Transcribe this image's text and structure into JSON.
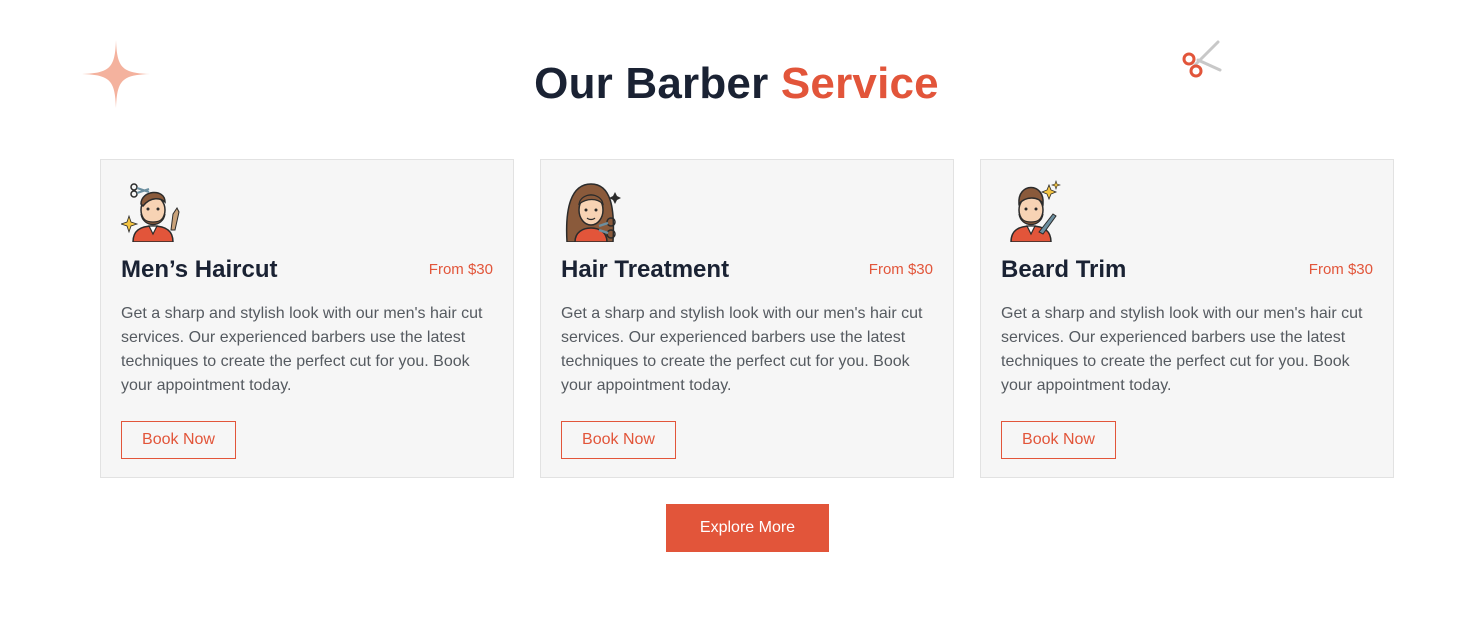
{
  "section": {
    "title_main": "Our Barber",
    "title_accent": "Service",
    "accent_color": "#e2553a",
    "decorations": [
      "sparkle-icon",
      "scissors-icon"
    ]
  },
  "cards": [
    {
      "icon": "barber-haircut-icon",
      "name": "Men’s Haircut",
      "price": "From $30",
      "description": "Get a sharp and stylish look with our men's hair cut services. Our experienced barbers use the latest techniques to create the perfect cut for you. Book your appointment today.",
      "button_label": "Book Now"
    },
    {
      "icon": "hair-treatment-icon",
      "name": "Hair Treatment",
      "price": "From $30",
      "description": "Get a sharp and stylish look with our men's hair cut services. Our experienced barbers use the latest techniques to create the perfect cut for you. Book your appointment today.",
      "button_label": "Book Now"
    },
    {
      "icon": "beard-trim-icon",
      "name": "Beard Trim",
      "price": "From $30",
      "description": "Get a sharp and stylish look with our men's hair cut services. Our experienced barbers use the latest techniques to create the perfect cut for you. Book your appointment today.",
      "button_label": "Book Now"
    }
  ],
  "explore_label": "Explore More"
}
